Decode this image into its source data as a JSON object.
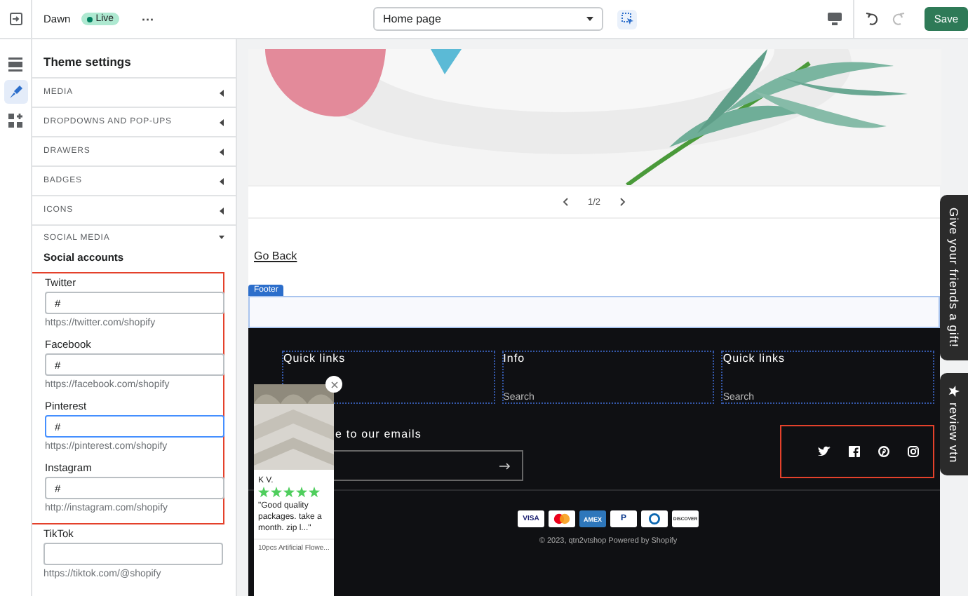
{
  "topbar": {
    "theme": "Dawn",
    "status": "Live",
    "more": "···",
    "page_select": "Home page",
    "undo_disabled": false,
    "redo_disabled": true,
    "save": "Save"
  },
  "rail": [
    {
      "kind": "sections",
      "selected": false
    },
    {
      "kind": "theme",
      "selected": true
    },
    {
      "kind": "apps",
      "selected": false
    }
  ],
  "panel": {
    "title": "Theme settings",
    "sections": [
      {
        "label": "MEDIA",
        "expanded": false
      },
      {
        "label": "DROPDOWNS AND POP-UPS",
        "expanded": false
      },
      {
        "label": "DRAWERS",
        "expanded": false
      },
      {
        "label": "BADGES",
        "expanded": false
      },
      {
        "label": "ICONS",
        "expanded": false
      },
      {
        "label": "SOCIAL MEDIA",
        "expanded": true
      }
    ],
    "subheading": "Social accounts",
    "accounts": [
      {
        "label": "Twitter",
        "value": "#",
        "hint": "https://twitter.com/shopify",
        "focused": false,
        "highlighted": true
      },
      {
        "label": "Facebook",
        "value": "#",
        "hint": "https://facebook.com/shopify",
        "focused": false,
        "highlighted": true
      },
      {
        "label": "Pinterest",
        "value": "#",
        "hint": "https://pinterest.com/shopify",
        "focused": true,
        "highlighted": true
      },
      {
        "label": "Instagram",
        "value": "#",
        "hint": "http://instagram.com/shopify",
        "focused": false,
        "highlighted": true
      },
      {
        "label": "TikTok",
        "hint": "https://tiktok.com/@shopify",
        "focused": false,
        "highlighted": false
      }
    ]
  },
  "preview": {
    "pager": "1/2",
    "link": "Go Back",
    "section_tag": "Footer",
    "footer": {
      "columns": [
        {
          "heading": "Quick links"
        },
        {
          "heading": "Info",
          "links": [
            "Search"
          ]
        },
        {
          "heading": "Quick links",
          "links": [
            "Search"
          ]
        }
      ],
      "subscribe_heading": "e to our emails",
      "social": {
        "highlighted": true,
        "icons": [
          {
            "kind": "twitter"
          },
          {
            "kind": "facebook"
          },
          {
            "kind": "pinterest"
          },
          {
            "kind": "instagram"
          }
        ]
      },
      "payments": [
        {
          "kind": "visa",
          "label": "VISA"
        },
        {
          "kind": "mastercard"
        },
        {
          "kind": "amex",
          "label": "AMEX"
        },
        {
          "kind": "paypal",
          "label": "P"
        },
        {
          "kind": "diners"
        },
        {
          "kind": "discover",
          "label": "DISCOVER"
        }
      ],
      "copyright": "© 2023, qtn2vtshop Powered by Shopify"
    },
    "review_popup": {
      "author": "K V.",
      "stars": 5,
      "quote": "\"Good quality packages. take a month. zip l...\"",
      "product": "10pcs Artificial Flowe..."
    },
    "side_tabs": [
      {
        "kind": "gift",
        "label": "Give your friends a gift!"
      },
      {
        "kind": "review",
        "label": "review vtn"
      }
    ]
  }
}
